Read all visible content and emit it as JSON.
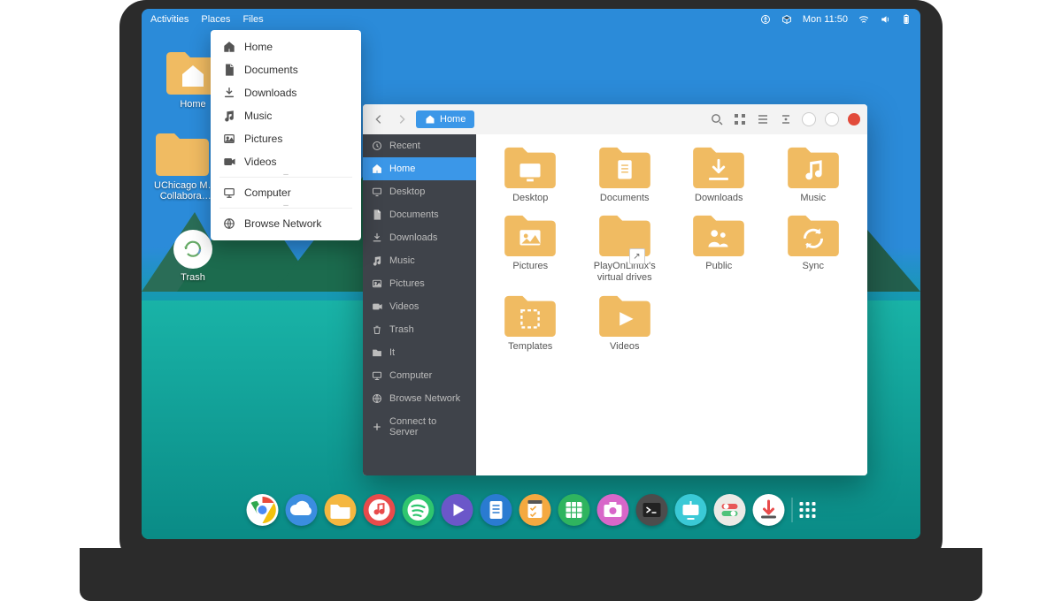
{
  "topbar": {
    "left": [
      "Activities",
      "Places",
      "Files"
    ],
    "clock": "Mon 11:50"
  },
  "desktop": {
    "items": [
      {
        "label": "Home"
      },
      {
        "label": "UChicago M…\nCollabora…"
      },
      {
        "label": "Trash",
        "type": "trash"
      }
    ]
  },
  "places_menu": {
    "items": [
      {
        "icon": "home",
        "label": "Home"
      },
      {
        "icon": "doc",
        "label": "Documents"
      },
      {
        "icon": "download",
        "label": "Downloads"
      },
      {
        "icon": "music",
        "label": "Music"
      },
      {
        "icon": "picture",
        "label": "Pictures"
      },
      {
        "icon": "video",
        "label": "Videos"
      },
      {
        "sep": true
      },
      {
        "icon": "computer",
        "label": "Computer"
      },
      {
        "sep": true
      },
      {
        "icon": "network",
        "label": "Browse Network"
      }
    ]
  },
  "files": {
    "location_label": "Home",
    "sidebar": [
      {
        "icon": "clock",
        "label": "Recent"
      },
      {
        "icon": "home",
        "label": "Home",
        "selected": true
      },
      {
        "icon": "desktop",
        "label": "Desktop"
      },
      {
        "icon": "doc",
        "label": "Documents"
      },
      {
        "icon": "download",
        "label": "Downloads"
      },
      {
        "icon": "music",
        "label": "Music"
      },
      {
        "icon": "picture",
        "label": "Pictures"
      },
      {
        "icon": "video",
        "label": "Videos"
      },
      {
        "icon": "trash",
        "label": "Trash"
      },
      {
        "icon": "folder",
        "label": "It"
      },
      {
        "icon": "computer",
        "label": "Computer"
      },
      {
        "icon": "network",
        "label": "Browse Network"
      },
      {
        "icon": "plus",
        "label": "Connect to Server"
      }
    ],
    "folders": [
      {
        "icon": "desktop",
        "label": "Desktop"
      },
      {
        "icon": "doc",
        "label": "Documents"
      },
      {
        "icon": "download",
        "label": "Downloads"
      },
      {
        "icon": "music",
        "label": "Music"
      },
      {
        "icon": "picture",
        "label": "Pictures"
      },
      {
        "icon": "blank",
        "label": "PlayOnLinux's virtual drives",
        "shortcut": true
      },
      {
        "icon": "public",
        "label": "Public"
      },
      {
        "icon": "sync",
        "label": "Sync"
      },
      {
        "icon": "template",
        "label": "Templates"
      },
      {
        "icon": "video",
        "label": "Videos"
      }
    ]
  },
  "dock": [
    {
      "name": "chrome",
      "bg": "#ffffff"
    },
    {
      "name": "cloud",
      "bg": "#3b8de0"
    },
    {
      "name": "files",
      "bg": "#f4b740"
    },
    {
      "name": "music",
      "bg": "#e84b4b"
    },
    {
      "name": "spotify",
      "bg": "#2fc66f"
    },
    {
      "name": "video",
      "bg": "#6b57c9"
    },
    {
      "name": "document",
      "bg": "#2a7bd1"
    },
    {
      "name": "tasks",
      "bg": "#f4a940"
    },
    {
      "name": "spreadsheet",
      "bg": "#2fb45f"
    },
    {
      "name": "camera",
      "bg": "#d867c9"
    },
    {
      "name": "terminal",
      "bg": "#4c4c4c"
    },
    {
      "name": "software",
      "bg": "#3ac9d6"
    },
    {
      "name": "settings",
      "bg": "#eceae6"
    },
    {
      "name": "transmission",
      "bg": "#fff"
    }
  ]
}
